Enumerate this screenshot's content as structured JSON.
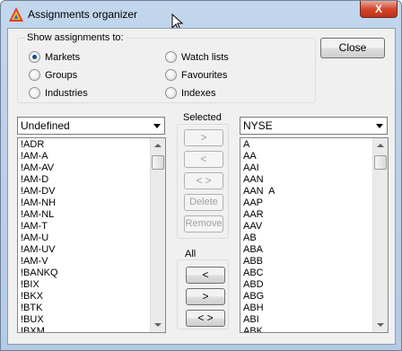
{
  "window": {
    "title": "Assignments organizer",
    "close_glyph": "X"
  },
  "show_group": {
    "label": "Show assignments to:",
    "options": [
      {
        "label": "Markets",
        "selected": true
      },
      {
        "label": "Watch lists",
        "selected": false
      },
      {
        "label": "Groups",
        "selected": false
      },
      {
        "label": "Favourites",
        "selected": false
      },
      {
        "label": "Industries",
        "selected": false
      },
      {
        "label": "Indexes",
        "selected": false
      }
    ]
  },
  "close_button": "Close",
  "left_combo": {
    "value": "Undefined"
  },
  "right_combo": {
    "value": "NYSE"
  },
  "selected_section": {
    "label": "Selected",
    "buttons": [
      ">",
      "<",
      "< >",
      "Delete",
      "Remove"
    ]
  },
  "all_section": {
    "label": "All",
    "buttons": [
      "<",
      ">",
      "< >"
    ]
  },
  "left_list": [
    "!ADR",
    "!AM-A",
    "!AM-AV",
    "!AM-D",
    "!AM-DV",
    "!AM-NH",
    "!AM-NL",
    "!AM-T",
    "!AM-U",
    "!AM-UV",
    "!AM-V",
    "!BANKQ",
    "!BIX",
    "!BKX",
    "!BTK",
    "!BUX",
    "!BXM"
  ],
  "right_list": [
    "A",
    "AA",
    "AAI",
    "AAN",
    "AAN  A",
    "AAP",
    "AAR",
    "AAV",
    "AB",
    "ABA",
    "ABB",
    "ABC",
    "ABD",
    "ABG",
    "ABH",
    "ABI",
    "ABK"
  ],
  "colors": {
    "title_bar": "#b4cbe5",
    "close_red": "#d2482d",
    "radio_dot": "#1b4d8a"
  }
}
